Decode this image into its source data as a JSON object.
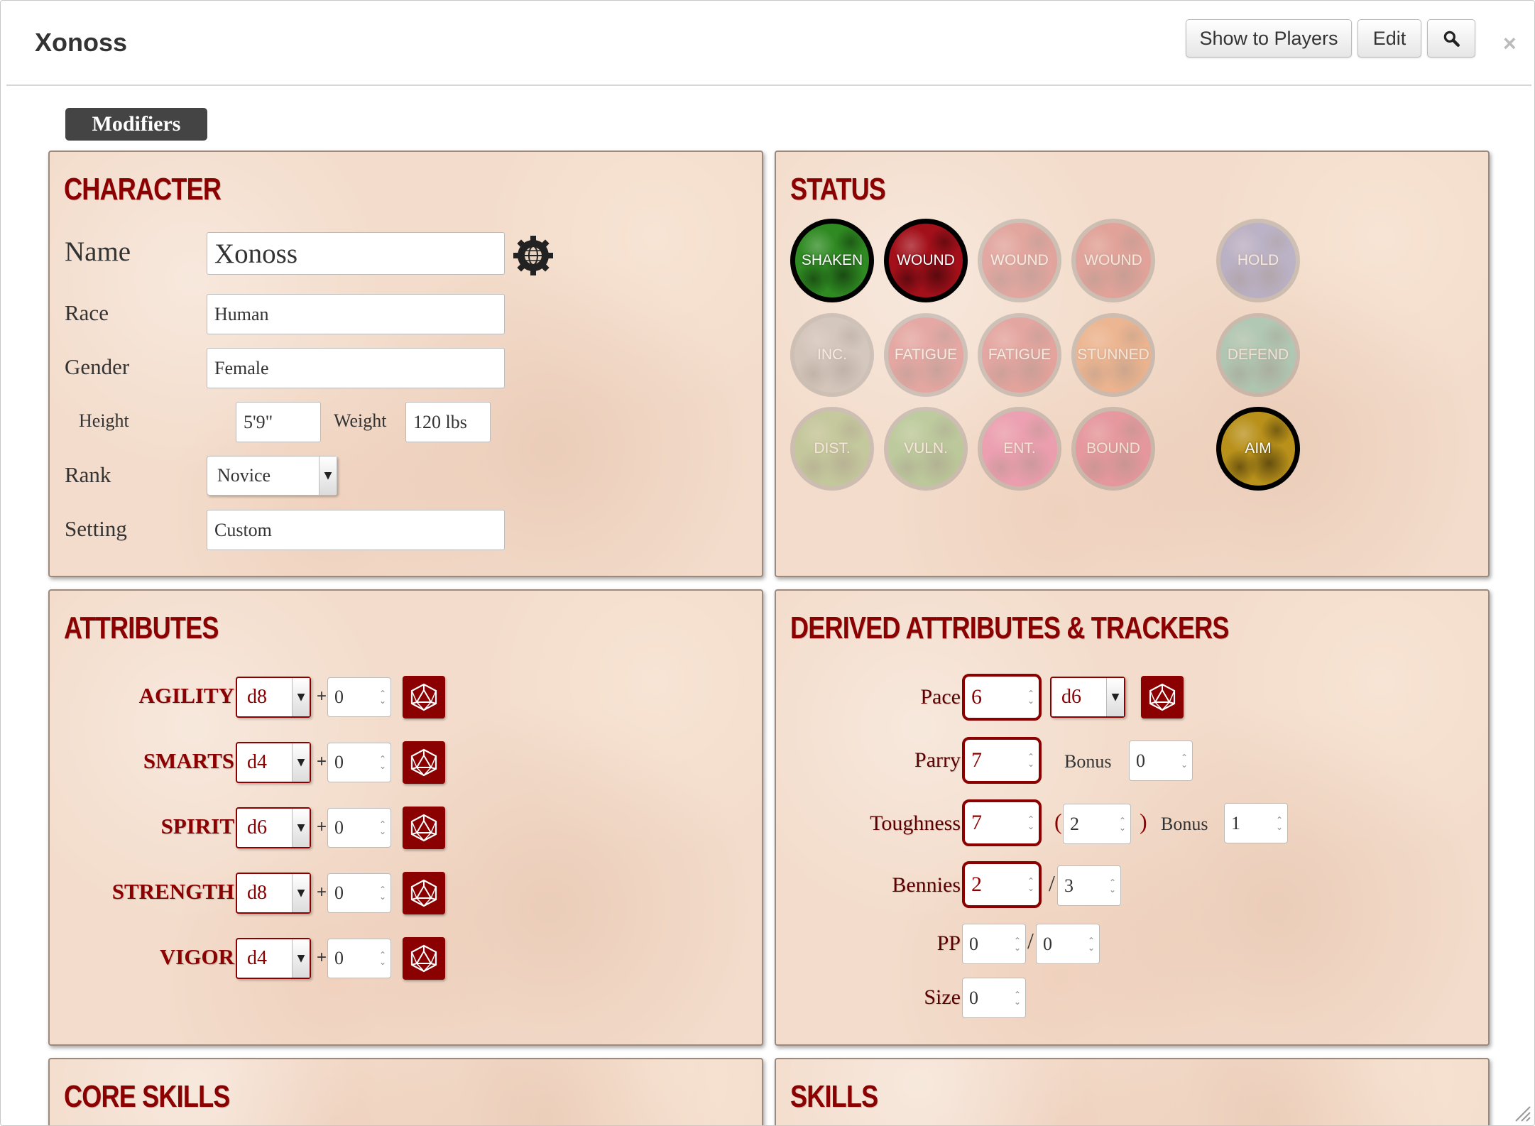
{
  "window": {
    "title": "Xonoss",
    "show_to_players": "Show to Players",
    "edit": "Edit"
  },
  "modifiers_label": "Modifiers",
  "character": {
    "title": "CHARACTER",
    "name_label": "Name",
    "name_value": "Xonoss",
    "race_label": "Race",
    "race_value": "Human",
    "gender_label": "Gender",
    "gender_value": "Female",
    "height_label": "Height",
    "height_value": "5'9\"",
    "weight_label": "Weight",
    "weight_value": "120 lbs",
    "rank_label": "Rank",
    "rank_value": "Novice",
    "setting_label": "Setting",
    "setting_value": "Custom"
  },
  "status": {
    "title": "STATUS",
    "items": [
      {
        "label": "SHAKEN",
        "active": true,
        "color": "#2f8a22"
      },
      {
        "label": "WOUND",
        "active": true,
        "color": "#a3101a"
      },
      {
        "label": "WOUND",
        "active": false,
        "color": "#b8202a"
      },
      {
        "label": "WOUND",
        "active": false,
        "color": "#b8202a"
      },
      {
        "label": "HOLD",
        "active": false,
        "color": "#3a4fb8"
      },
      {
        "label": "INC.",
        "active": false,
        "color": "#8a8a8a"
      },
      {
        "label": "FATIGUE",
        "active": false,
        "color": "#c02030"
      },
      {
        "label": "FATIGUE",
        "active": false,
        "color": "#c02030"
      },
      {
        "label": "STUNNED",
        "active": false,
        "color": "#e06010"
      },
      {
        "label": "DEFEND",
        "active": false,
        "color": "#20a890"
      },
      {
        "label": "DIST.",
        "active": false,
        "color": "#5a9a30"
      },
      {
        "label": "VULN.",
        "active": false,
        "color": "#40a030"
      },
      {
        "label": "ENT.",
        "active": false,
        "color": "#e02080"
      },
      {
        "label": "BOUND",
        "active": false,
        "color": "#d01050"
      },
      {
        "label": "AIM",
        "active": true,
        "color": "#b8901a"
      }
    ]
  },
  "attributes": {
    "title": "ATTRIBUTES",
    "plus": "+",
    "items": [
      {
        "label": "AGILITY",
        "die": "d8",
        "mod": "0"
      },
      {
        "label": "SMARTS",
        "die": "d4",
        "mod": "0"
      },
      {
        "label": "SPIRIT",
        "die": "d6",
        "mod": "0"
      },
      {
        "label": "STRENGTH",
        "die": "d8",
        "mod": "0"
      },
      {
        "label": "VIGOR",
        "die": "d4",
        "mod": "0"
      }
    ]
  },
  "derived": {
    "title": "DERIVED ATTRIBUTES & TRACKERS",
    "pace_label": "Pace",
    "pace_value": "6",
    "pace_die": "d6",
    "parry_label": "Parry",
    "parry_value": "7",
    "parry_bonus_label": "Bonus",
    "parry_bonus": "0",
    "toughness_label": "Toughness",
    "toughness_value": "7",
    "toughness_open_paren": "(",
    "toughness_armor": "2",
    "toughness_close_paren": ")",
    "toughness_bonus_label": "Bonus",
    "toughness_bonus": "1",
    "bennies_label": "Bennies",
    "bennies_value": "2",
    "bennies_slash": "/",
    "bennies_max": "3",
    "pp_label": "PP",
    "pp_value": "0",
    "pp_slash": "/",
    "pp_max": "0",
    "size_label": "Size",
    "size_value": "0"
  },
  "core_skills": {
    "title": "CORE SKILLS"
  },
  "skills": {
    "title": "SKILLS"
  }
}
